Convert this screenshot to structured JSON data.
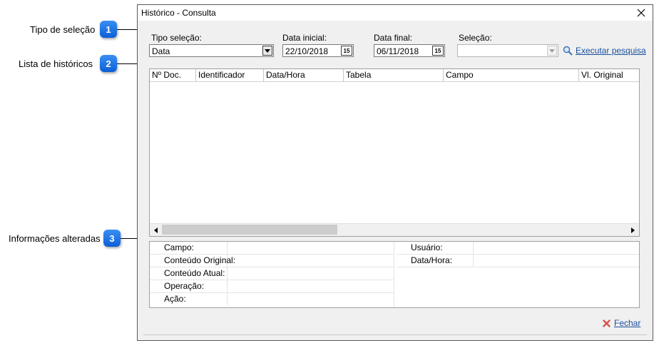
{
  "callouts": [
    {
      "label": "Tipo de seleção",
      "number": "1"
    },
    {
      "label": "Lista de históricos",
      "number": "2"
    },
    {
      "label": "Informações alteradas",
      "number": "3"
    }
  ],
  "window": {
    "title": "Histórico - Consulta"
  },
  "filters": {
    "tipo_label": "Tipo seleção:",
    "tipo_value": "Data",
    "data_inicial_label": "Data inicial:",
    "data_inicial_value": "22/10/2018",
    "data_final_label": "Data final:",
    "data_final_value": "06/11/2018",
    "selecao_label": "Seleção:",
    "selecao_value": "",
    "calendar_glyph": "15",
    "execute_label": "Executar pesquisa"
  },
  "grid": {
    "columns": [
      "Nº Doc.",
      "Identificador",
      "Data/Hora",
      "Tabela",
      "Campo",
      "Vl. Original"
    ],
    "rows": []
  },
  "info": {
    "left_labels": [
      "Campo:",
      "Conteúdo Original:",
      "Conteúdo Atual:",
      "Operação:",
      "Ação:"
    ],
    "right_labels": [
      "Usuário:",
      "Data/Hora:"
    ]
  },
  "footer": {
    "close_label": "Fechar"
  },
  "colors": {
    "badge": "#1a73e8",
    "link": "#1a4f9c",
    "close_icon": "#d9534f"
  }
}
